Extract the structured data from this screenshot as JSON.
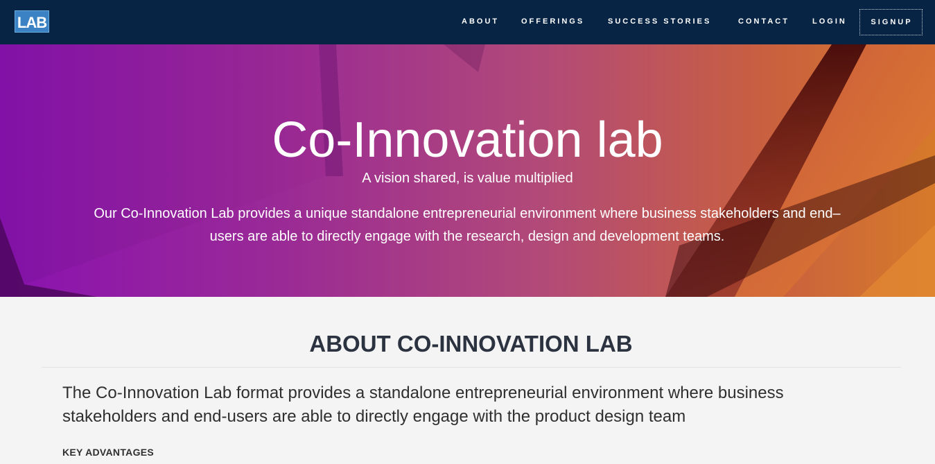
{
  "header": {
    "logo_text": "LAB",
    "logo_small_text": "",
    "nav": {
      "about": "ABOUT",
      "offerings": "OFFERINGS",
      "success_stories": "SUCCESS STORIES",
      "contact": "CONTACT",
      "login": "LOGIN",
      "signup": "SIGNUP"
    },
    "colors": {
      "background": "#072445",
      "logo": "#3b82c4"
    }
  },
  "hero": {
    "title": "Co-Innovation lab",
    "tagline": "A vision shared, is value multiplied",
    "description": "Our Co-Innovation Lab provides a unique standalone entrepreneurial environment where business stakeholders and end–users are able to directly engage with the research, design and development teams.",
    "gradient_colors": [
      "#8a12b0",
      "#b24a78",
      "#d67a2a"
    ]
  },
  "about": {
    "title": "ABOUT CO-INNOVATION LAB",
    "text": "The Co-Innovation Lab format provides a standalone entrepreneurial environment where business stakeholders and end-users are able to directly engage with the product design team",
    "key_advantages": "KEY ADVANTAGES"
  }
}
